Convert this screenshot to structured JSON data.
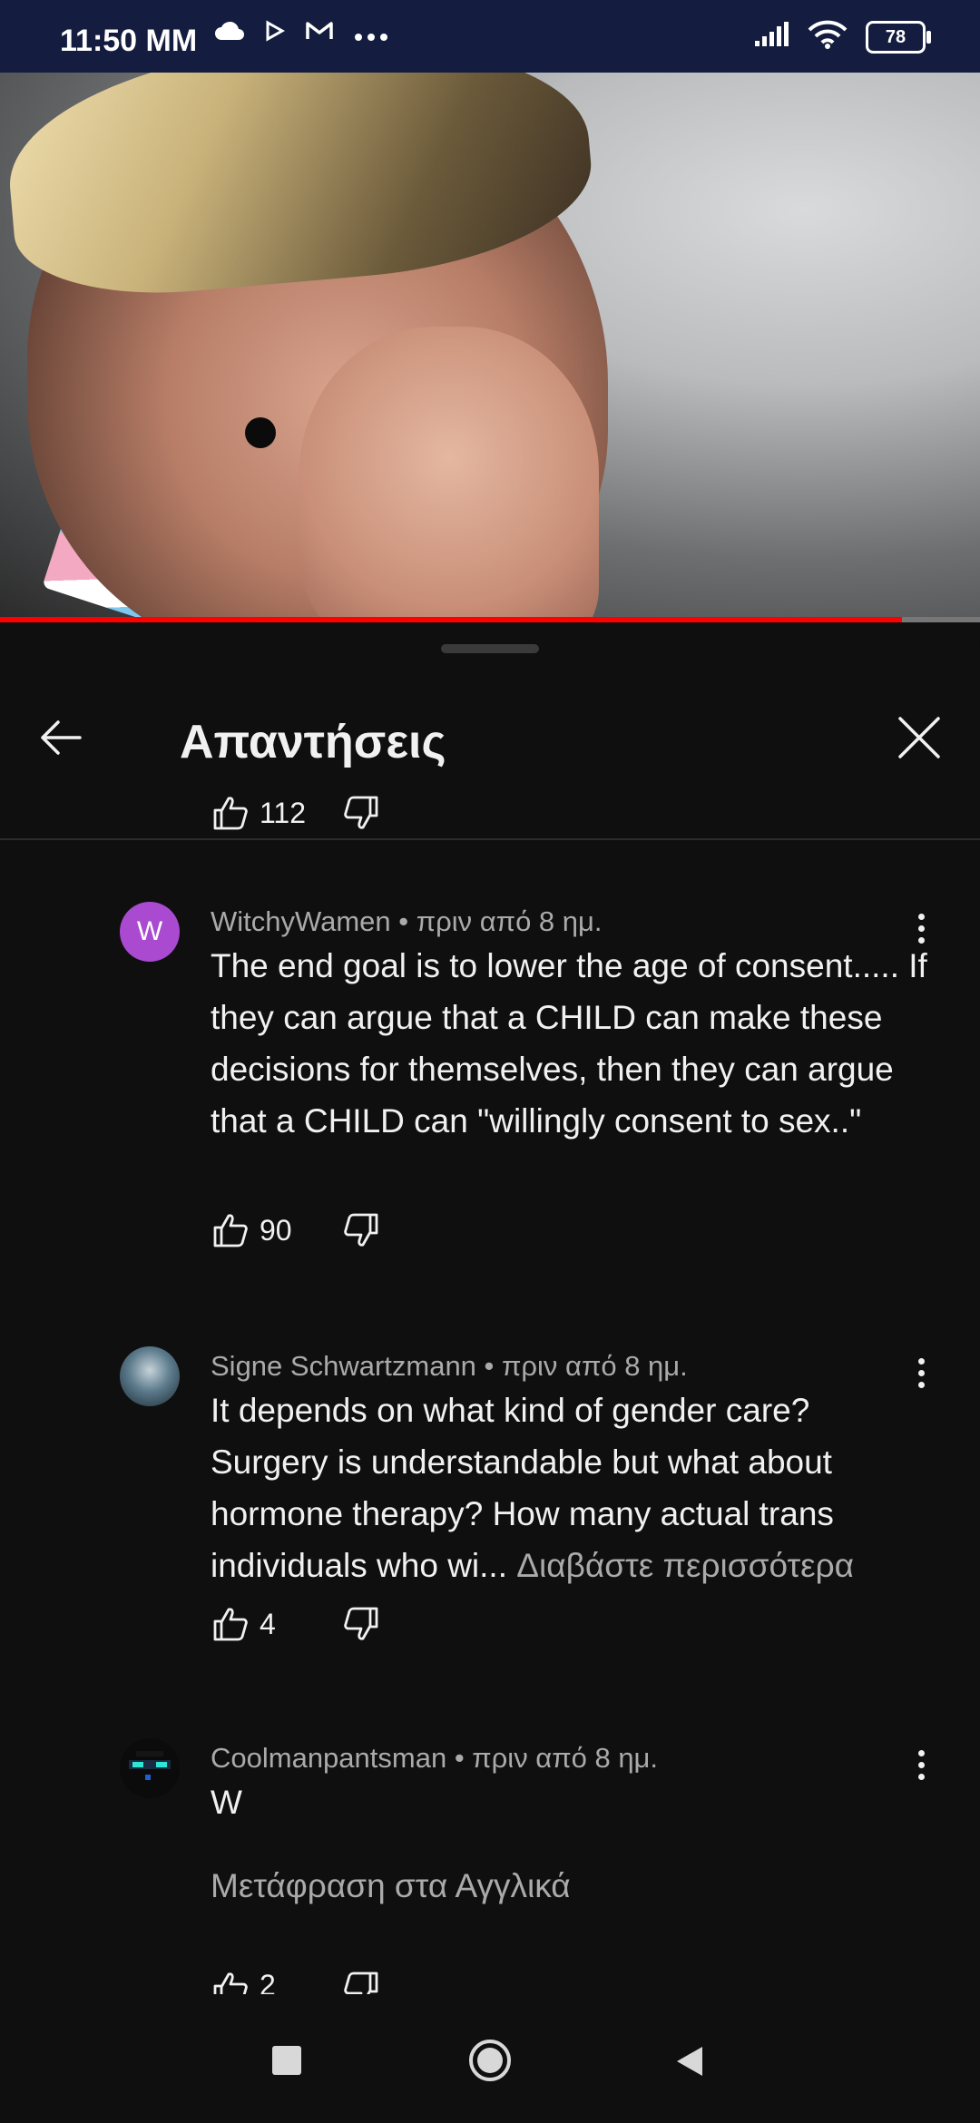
{
  "status_bar": {
    "time": "11:50 MM",
    "battery": "78",
    "icons_left": [
      "cloud-icon",
      "play-icon",
      "gmail-icon",
      "more-dots-icon"
    ],
    "icons_right": [
      "signal-icon",
      "wifi-icon",
      "battery-icon"
    ]
  },
  "player": {
    "progress_fraction": 0.92
  },
  "sheet": {
    "title": "Απαντήσεις",
    "top_like_count": "112"
  },
  "comments": [
    {
      "author": "WitchyWamen",
      "time": "πριν από 8 ημ.",
      "meta": "WitchyWamen • πριν από 8 ημ.",
      "avatar_letter": "W",
      "avatar_color": "#a94ad1",
      "text": "The end goal is to lower the age of consent..... If they can argue that a CHILD can make these decisions for themselves, then they can argue that a CHILD can \"willingly consent to sex..\"",
      "likes": "90"
    },
    {
      "author": "Signe Schwartzmann",
      "time": "πριν από 8 ημ.",
      "meta": "Signe Schwartzmann • πριν από 8 ημ.",
      "text": "It depends on what kind of gender care? Surgery is understandable but what about hormone therapy? How many actual trans individuals who wi...",
      "more_label": "Διαβάστε περισσότερα",
      "likes": "4"
    },
    {
      "author": "Coolmanpantsman",
      "time": "πριν από 8 ημ.",
      "meta": "Coolmanpantsman • πριν από 8 ημ.",
      "text": "W",
      "translate_label": "Μετάφραση στα Αγγλικά",
      "likes": "2"
    }
  ],
  "colors": {
    "background": "#0f0f0f",
    "status_bar": "#141d3f",
    "progress": "#ff0000",
    "secondary_text": "#aaaaaa"
  }
}
